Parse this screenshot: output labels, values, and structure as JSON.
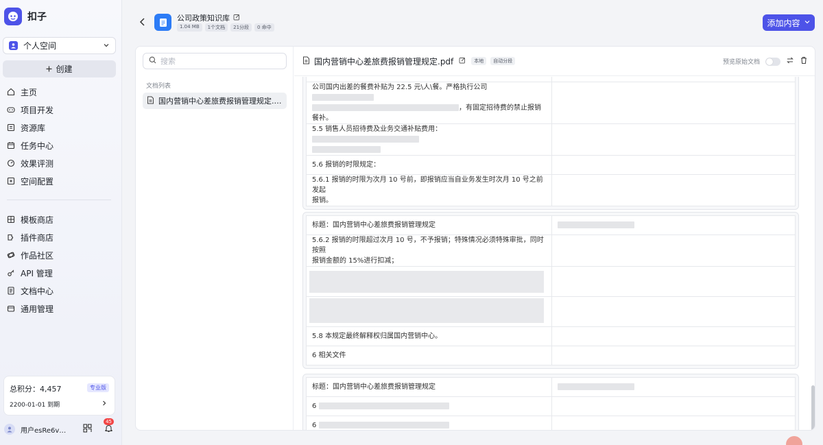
{
  "app": {
    "name": "扣子"
  },
  "sidebar": {
    "space": "个人空间",
    "create_label": "创建",
    "nav_primary": [
      {
        "label": "主页",
        "icon": "home-icon"
      },
      {
        "label": "项目开发",
        "icon": "gamepad-icon"
      },
      {
        "label": "资源库",
        "icon": "library-icon"
      },
      {
        "label": "任务中心",
        "icon": "calendar-icon"
      },
      {
        "label": "效果评测",
        "icon": "gauge-icon"
      },
      {
        "label": "空间配置",
        "icon": "config-icon"
      }
    ],
    "nav_secondary": [
      {
        "label": "模板商店",
        "icon": "template-icon"
      },
      {
        "label": "插件商店",
        "icon": "plugin-icon"
      },
      {
        "label": "作品社区",
        "icon": "community-icon"
      },
      {
        "label": "API 管理",
        "icon": "api-icon"
      },
      {
        "label": "文档中心",
        "icon": "doc-icon"
      },
      {
        "label": "通用管理",
        "icon": "settings-icon"
      }
    ],
    "points": {
      "label": "总积分：4,457",
      "badge": "专业版",
      "expiry": "2200-01-01 到期"
    },
    "user": {
      "name": "用户esRe6v@...",
      "notifications": "45"
    }
  },
  "header": {
    "kb_title": "公司政策知识库",
    "tags": [
      "1.04 MB",
      "1个文档",
      "21分段",
      "0 命中"
    ],
    "add_button": "添加内容"
  },
  "doc_list": {
    "search_placeholder": "搜索",
    "heading": "文档列表",
    "items": [
      "国内营销中心差旅费报销管理规定.pdf"
    ]
  },
  "content": {
    "doc_name": "国内营销中心差旅费报销管理规定.pdf",
    "tags": [
      "本地",
      "自动分段"
    ],
    "preview_label": "预览原始文档",
    "seg1": {
      "r1a": "公司国内出差的餐费补贴为 22.5 元\\人\\餐。严格执行公司",
      "r1b": "，有固定招待费的禁止报销",
      "r1c": "餐补。",
      "r2": "5.5 销售人员招待费及业务交通补贴费用：",
      "r3": "5.6 报销的时限规定：",
      "r4a": "5.6.1 报销的时限为次月 10 号前，即报销应当自业务发生时次月 10 号之前发起",
      "r4b": "报销。"
    },
    "seg2": {
      "title": "标题：国内营销中心差旅费报销管理规定",
      "r2a": "5.6.2 报销的时限超过次月 10 号，不予报销；特殊情况必须特殊审批，同时按照",
      "r2b": "报销金额的 15%进行扣减；",
      "r5": "5.8 本规定最终解释权归属国内营销中心。",
      "r6": "6 相关文件"
    },
    "seg3": {
      "title": "标题：国内营销中心差旅费报销管理规定",
      "r2": "6",
      "r3": "6"
    }
  },
  "colors": {
    "accent": "#4d53e8",
    "kb_icon": "#2d7cf6",
    "badge": "#f24545"
  }
}
